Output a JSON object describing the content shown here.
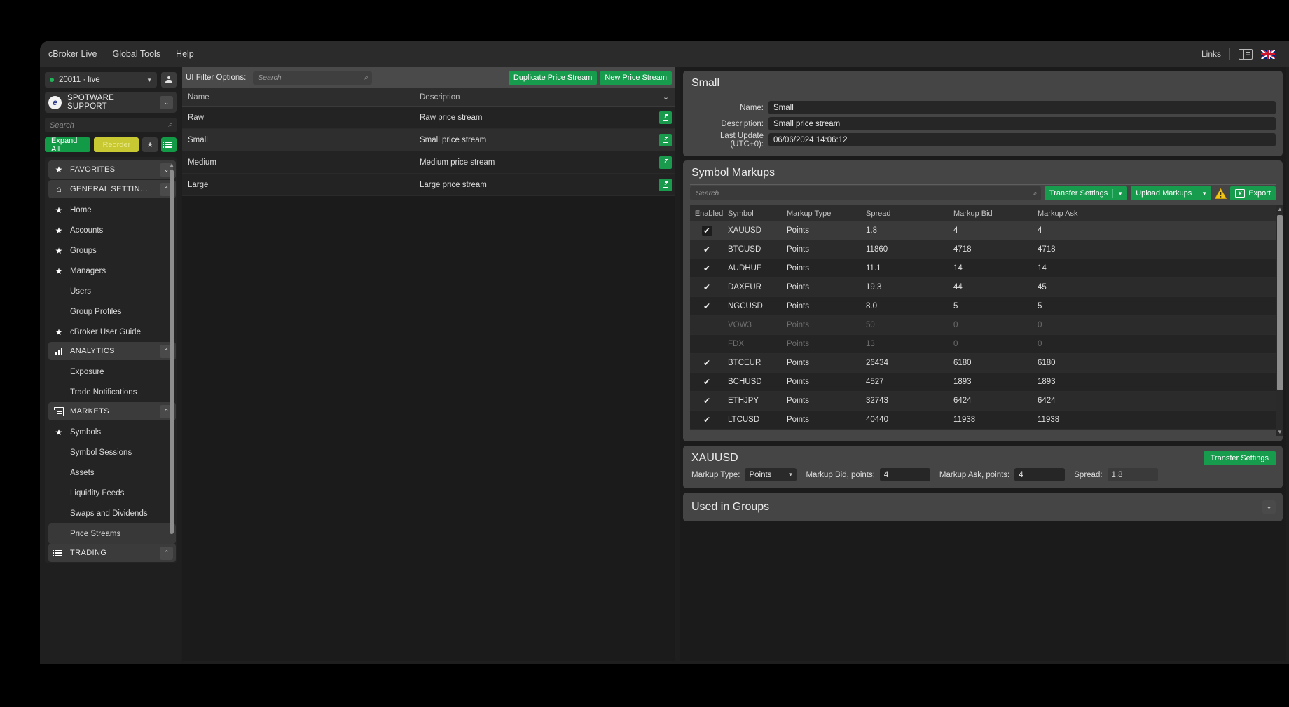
{
  "menubar": {
    "items": [
      "cBroker Live",
      "Global Tools",
      "Help"
    ],
    "links_label": "Links"
  },
  "sidebar": {
    "account": {
      "value": "20011 · live",
      "status_color": "#1eb457"
    },
    "brand": {
      "name": "SPOTWARE SUPPORT",
      "logo_letter": "e"
    },
    "search_placeholder": "Search",
    "buttons": {
      "expand_all": "Expand All",
      "reorder": "Reorder"
    },
    "nav": [
      {
        "type": "group",
        "label": "FAVORITES",
        "icon": "star-icon",
        "expanded": false
      },
      {
        "type": "group",
        "label": "GENERAL SETTIN…",
        "icon": "home-icon",
        "expanded": true
      },
      {
        "type": "item",
        "label": "Home",
        "icon": "star-icon"
      },
      {
        "type": "item",
        "label": "Accounts",
        "icon": "star-icon"
      },
      {
        "type": "item",
        "label": "Groups",
        "icon": "star-icon"
      },
      {
        "type": "item",
        "label": "Managers",
        "icon": "star-icon"
      },
      {
        "type": "item",
        "label": "Users",
        "icon": ""
      },
      {
        "type": "item",
        "label": "Group Profiles",
        "icon": ""
      },
      {
        "type": "item",
        "label": "cBroker User Guide",
        "icon": "star-icon"
      },
      {
        "type": "group",
        "label": "ANALYTICS",
        "icon": "bars-icon",
        "expanded": true
      },
      {
        "type": "item",
        "label": "Exposure",
        "icon": ""
      },
      {
        "type": "item",
        "label": "Trade Notifications",
        "icon": ""
      },
      {
        "type": "group",
        "label": "MARKETS",
        "icon": "shop-icon",
        "expanded": true
      },
      {
        "type": "item",
        "label": "Symbols",
        "icon": "star-icon"
      },
      {
        "type": "item",
        "label": "Symbol Sessions",
        "icon": ""
      },
      {
        "type": "item",
        "label": "Assets",
        "icon": ""
      },
      {
        "type": "item",
        "label": "Liquidity Feeds",
        "icon": ""
      },
      {
        "type": "item",
        "label": "Swaps and Dividends",
        "icon": ""
      },
      {
        "type": "item",
        "label": "Price Streams",
        "icon": "",
        "active": true
      },
      {
        "type": "group",
        "label": "TRADING",
        "icon": "list-icon",
        "expanded": true
      }
    ]
  },
  "center": {
    "filter_label": "UI Filter Options:",
    "search_placeholder": "Search",
    "duplicate_button": "Duplicate Price Stream",
    "new_button": "New Price Stream",
    "columns": [
      "Name",
      "Description"
    ],
    "rows": [
      {
        "name": "Raw",
        "description": "Raw price stream"
      },
      {
        "name": "Small",
        "description": "Small price stream",
        "selected": true
      },
      {
        "name": "Medium",
        "description": "Medium price stream"
      },
      {
        "name": "Large",
        "description": "Large price stream"
      }
    ]
  },
  "right": {
    "stream": {
      "title": "Small",
      "name_label": "Name:",
      "name_value": "Small",
      "description_label": "Description:",
      "description_value": "Small price stream",
      "last_update_label": "Last Update (UTC+0):",
      "last_update_value": "06/06/2024 14:06:12"
    },
    "markups": {
      "title": "Symbol Markups",
      "search_placeholder": "Search",
      "transfer_settings_label": "Transfer Settings",
      "upload_markups_label": "Upload Markups",
      "export_label": "Export",
      "columns": [
        "Enabled",
        "Symbol",
        "Markup Type",
        "Spread",
        "Markup Bid",
        "Markup Ask"
      ],
      "rows": [
        {
          "enabled": true,
          "symbol": "XAUUSD",
          "type": "Points",
          "spread": "1.8",
          "bid": "4",
          "ask": "4",
          "selected": true
        },
        {
          "enabled": true,
          "symbol": "BTCUSD",
          "type": "Points",
          "spread": "11860",
          "bid": "4718",
          "ask": "4718"
        },
        {
          "enabled": true,
          "symbol": "AUDHUF",
          "type": "Points",
          "spread": "11.1",
          "bid": "14",
          "ask": "14"
        },
        {
          "enabled": true,
          "symbol": "DAXEUR",
          "type": "Points",
          "spread": "19.3",
          "bid": "44",
          "ask": "45"
        },
        {
          "enabled": true,
          "symbol": "NGCUSD",
          "type": "Points",
          "spread": "8.0",
          "bid": "5",
          "ask": "5"
        },
        {
          "enabled": false,
          "symbol": "VOW3",
          "type": "Points",
          "spread": "50",
          "bid": "0",
          "ask": "0"
        },
        {
          "enabled": false,
          "symbol": "FDX",
          "type": "Points",
          "spread": "13",
          "bid": "0",
          "ask": "0"
        },
        {
          "enabled": true,
          "symbol": "BTCEUR",
          "type": "Points",
          "spread": "26434",
          "bid": "6180",
          "ask": "6180"
        },
        {
          "enabled": true,
          "symbol": "BCHUSD",
          "type": "Points",
          "spread": "4527",
          "bid": "1893",
          "ask": "1893"
        },
        {
          "enabled": true,
          "symbol": "ETHJPY",
          "type": "Points",
          "spread": "32743",
          "bid": "6424",
          "ask": "6424"
        },
        {
          "enabled": true,
          "symbol": "LTCUSD",
          "type": "Points",
          "spread": "40440",
          "bid": "11938",
          "ask": "11938"
        }
      ]
    },
    "detail": {
      "title": "XAUUSD",
      "transfer_settings_label": "Transfer Settings",
      "markup_type_label": "Markup Type:",
      "markup_type_value": "Points",
      "markup_bid_label": "Markup Bid, points:",
      "markup_bid_value": "4",
      "markup_ask_label": "Markup Ask, points:",
      "markup_ask_value": "4",
      "spread_label": "Spread:",
      "spread_value": "1.8"
    },
    "used_in_groups": {
      "title": "Used in Groups"
    }
  },
  "colors": {
    "accent_green": "#179b4c",
    "accent_yellow": "#c8c832",
    "warning": "#f2c618",
    "status_dot": "#1eb457"
  }
}
